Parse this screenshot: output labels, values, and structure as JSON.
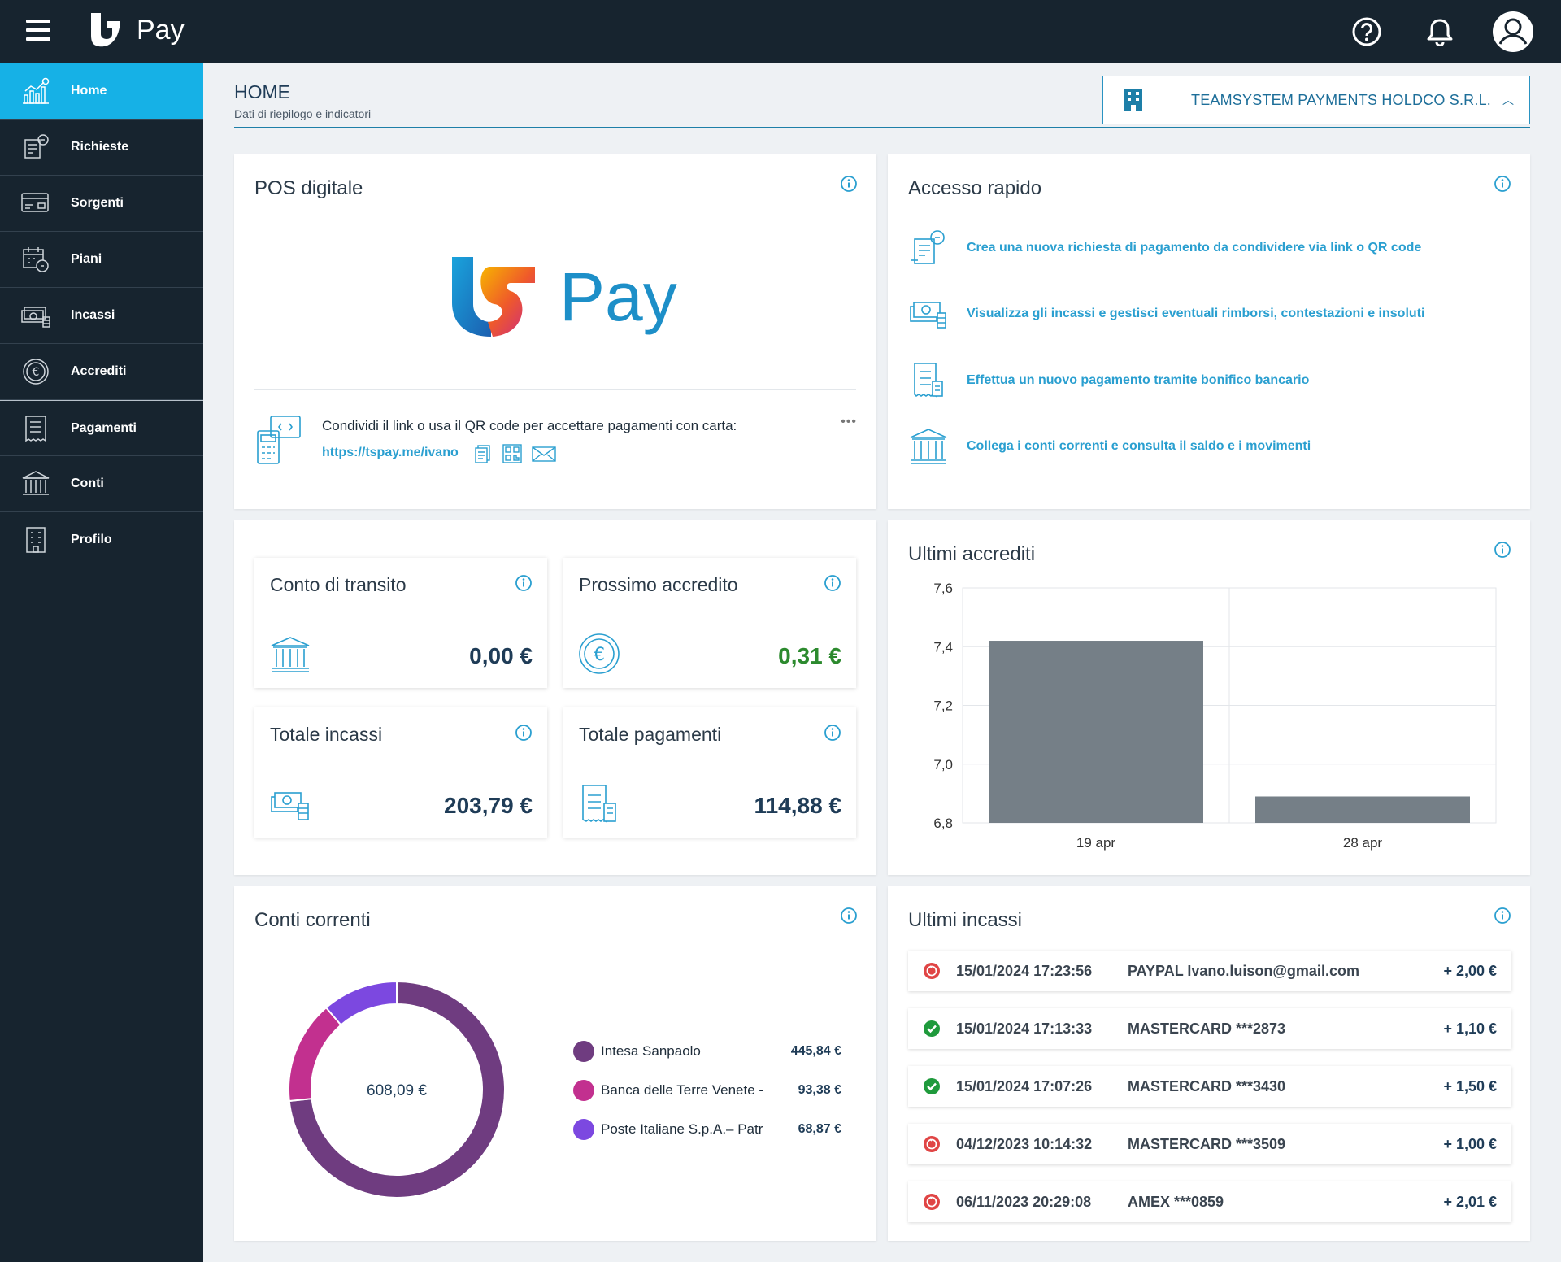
{
  "app": {
    "brand": "Pay"
  },
  "sidebar": {
    "items": [
      {
        "label": "Home",
        "icon": "chart-icon"
      },
      {
        "label": "Richieste",
        "icon": "request-icon"
      },
      {
        "label": "Sorgenti",
        "icon": "card-icon"
      },
      {
        "label": "Piani",
        "icon": "calendar-icon"
      },
      {
        "label": "Incassi",
        "icon": "cash-icon"
      },
      {
        "label": "Accrediti",
        "icon": "euro-icon"
      },
      {
        "label": "Pagamenti",
        "icon": "receipt-icon"
      },
      {
        "label": "Conti",
        "icon": "bank-icon"
      },
      {
        "label": "Profilo",
        "icon": "building-icon"
      }
    ]
  },
  "header": {
    "title": "HOME",
    "subtitle": "Dati di riepilogo e indicatori",
    "company": "TEAMSYSTEM PAYMENTS HOLDCO S.R.L."
  },
  "pos": {
    "title": "POS digitale",
    "brand": "Pay",
    "text": "Condividi il link o usa il QR code per accettare pagamenti con carta:",
    "link": "https://tspay.me/ivano",
    "more": "•••"
  },
  "quick": {
    "title": "Accesso rapido",
    "items": [
      "Crea una nuova richiesta di pagamento da condividere via link o QR code",
      "Visualizza gli incassi e gestisci eventuali rimborsi, contestazioni e insoluti",
      "Effettua un nuovo pagamento tramite bonifico bancario",
      "Collega i conti correnti e consulta il saldo e i movimenti"
    ]
  },
  "stats": {
    "transit": {
      "title": "Conto di transito",
      "value": "0,00 €"
    },
    "next": {
      "title": "Prossimo accredito",
      "value": "0,31 €",
      "color": "#2c8a2e"
    },
    "incassi": {
      "title": "Totale incassi",
      "value": "203,79 €"
    },
    "pagamenti": {
      "title": "Totale pagamenti",
      "value": "114,88 €"
    }
  },
  "accrediti": {
    "title": "Ultimi accrediti"
  },
  "chart_data": [
    {
      "type": "bar",
      "title": "Ultimi accrediti",
      "categories": [
        "19 apr",
        "28 apr"
      ],
      "values": [
        7.42,
        6.89
      ],
      "ylim": [
        6.8,
        7.6
      ],
      "yticks": [
        "7,6",
        "7,4",
        "7,2",
        "7,0",
        "6,8"
      ],
      "ytick_values": [
        7.6,
        7.4,
        7.2,
        7.0,
        6.8
      ],
      "grid": true,
      "color": "#757f87"
    },
    {
      "type": "pie",
      "title": "Conti correnti",
      "center_label": "608,09 €",
      "labels": [
        "Intesa Sanpaolo",
        "Banca delle Terre Venete -",
        "Poste Italiane S.p.A.– Patr"
      ],
      "values": [
        445.84,
        93.38,
        68.87
      ],
      "value_labels": [
        "445,84 €",
        "93,38 €",
        "68,87 €"
      ],
      "colors": [
        "#6f3c80",
        "#c2308f",
        "#7c48e0"
      ],
      "legend": "right"
    }
  ],
  "conti": {
    "title": "Conti correnti"
  },
  "incassi": {
    "title": "Ultimi incassi",
    "rows": [
      {
        "date": "15/01/2024 17:23:56",
        "desc": "PAYPAL Ivano.luison@gmail.com",
        "amount": "+ 2,00 €",
        "status": "refund"
      },
      {
        "date": "15/01/2024 17:13:33",
        "desc": "MASTERCARD ***2873",
        "amount": "+ 1,10 €",
        "status": "ok"
      },
      {
        "date": "15/01/2024 17:07:26",
        "desc": "MASTERCARD ***3430",
        "amount": "+ 1,50 €",
        "status": "ok"
      },
      {
        "date": "04/12/2023 10:14:32",
        "desc": "MASTERCARD ***3509",
        "amount": "+ 1,00 €",
        "status": "refund"
      },
      {
        "date": "06/11/2023 20:29:08",
        "desc": "AMEX ***0859",
        "amount": "+ 2,01 €",
        "status": "refund"
      }
    ]
  },
  "colors": {
    "accent": "#16b1e6",
    "link": "#2a9fd0",
    "dark": "#17242f"
  }
}
